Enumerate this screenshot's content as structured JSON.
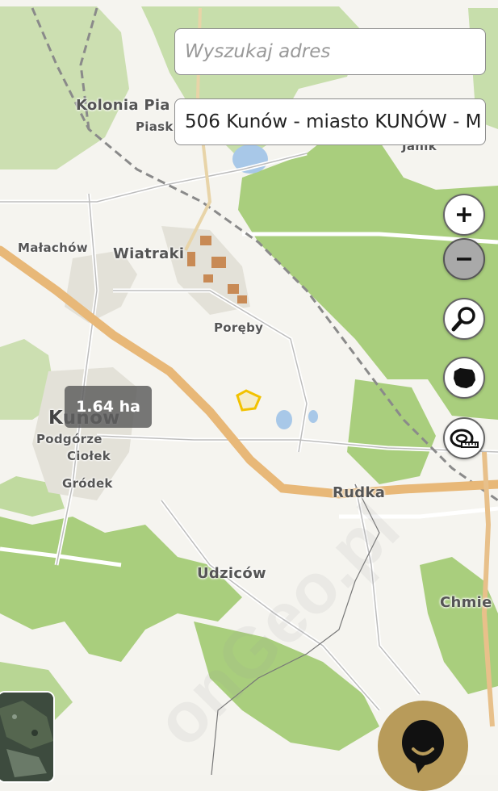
{
  "search": {
    "address_placeholder": "Wyszukaj adres",
    "parcel_value": "506 Kunów - miasto KUNÓW - M"
  },
  "controls": [
    {
      "name": "zoom-in-icon",
      "symbol": "+"
    },
    {
      "name": "zoom-out-icon",
      "symbol": "−"
    },
    {
      "name": "search-map-icon"
    },
    {
      "name": "poland-map-icon"
    },
    {
      "name": "measure-tape-icon"
    }
  ],
  "map": {
    "area_label": "1.64 ha",
    "place_labels": {
      "kolonia": "Kolonia Pia",
      "piask": "Piask",
      "janik": "Janik",
      "malachow": "Małachów",
      "wiatraki": "Wiatraki",
      "poreby": "Poręby",
      "kunow": "Kunów",
      "podgorze": "Podgórze",
      "ciolek": "Ciołek",
      "grodek": "Gródek",
      "rudka": "Rudka",
      "udzicow": "Udziców",
      "chmie": "Chmie"
    },
    "colors": {
      "forest": "#a7cd7b",
      "road_main": "#e8b878",
      "railway": "#888888",
      "water": "#a8c8e8",
      "parcel_outline": "#f2c200",
      "accent_gold": "#b89b5a"
    }
  }
}
